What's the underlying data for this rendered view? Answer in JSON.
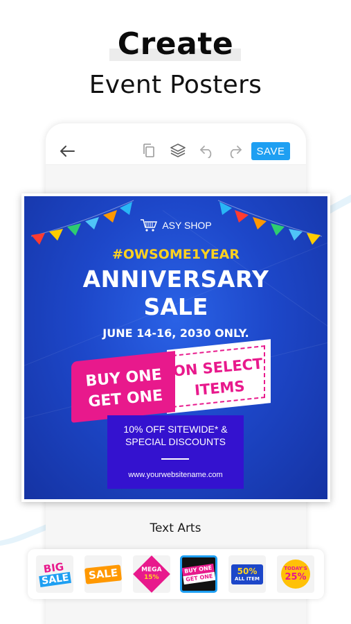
{
  "headline": {
    "title": "Create",
    "subtitle": "Event Posters"
  },
  "toolbar": {
    "back_icon": "arrow-left-icon",
    "copy_icon": "copy-icon",
    "layers_icon": "layers-icon",
    "undo_icon": "undo-icon",
    "redo_icon": "redo-icon",
    "save_label": "SAVE",
    "accent": "#1e9ff2"
  },
  "poster": {
    "shop_name": "ASY SHOP",
    "hashtag": "#OWSOME1YEAR",
    "title_line1": "ANNIVERSARY",
    "title_line2": "SALE",
    "dates": "JUNE 14-16, 2030 ONLY.",
    "promo_left_line1": "BUY ONE",
    "promo_left_line2": "GET ONE",
    "promo_right_line1": "ON SELECT",
    "promo_right_line2": "ITEMS",
    "discount_line1": "10% OFF SITEWIDE* &",
    "discount_line2": "SPECIAL DISCOUNTS",
    "website": "www.yourwebsitename.com",
    "colors": {
      "background": "#1d47c9",
      "hashtag": "#ffd21f",
      "pink": "#e8198c",
      "discount_box": "#3412cf"
    }
  },
  "section_label": "Text Arts",
  "text_arts": [
    {
      "name": "big-sale-art",
      "line1": "BIG",
      "line2": "SALE"
    },
    {
      "name": "sale-burst-art",
      "line1": "SALE",
      "line2": ""
    },
    {
      "name": "mega-discount-art",
      "line1": "MEGA",
      "line2": "15%"
    },
    {
      "name": "buy-one-get-one-art",
      "line1": "BUY ONE",
      "line2": "GET ONE",
      "selected": true
    },
    {
      "name": "fifty-percent-all-item-art",
      "line1": "50%",
      "line2": "ALL ITEM"
    },
    {
      "name": "today-25-percent-art",
      "line1": "TODAY'S",
      "line2": "25%"
    }
  ]
}
